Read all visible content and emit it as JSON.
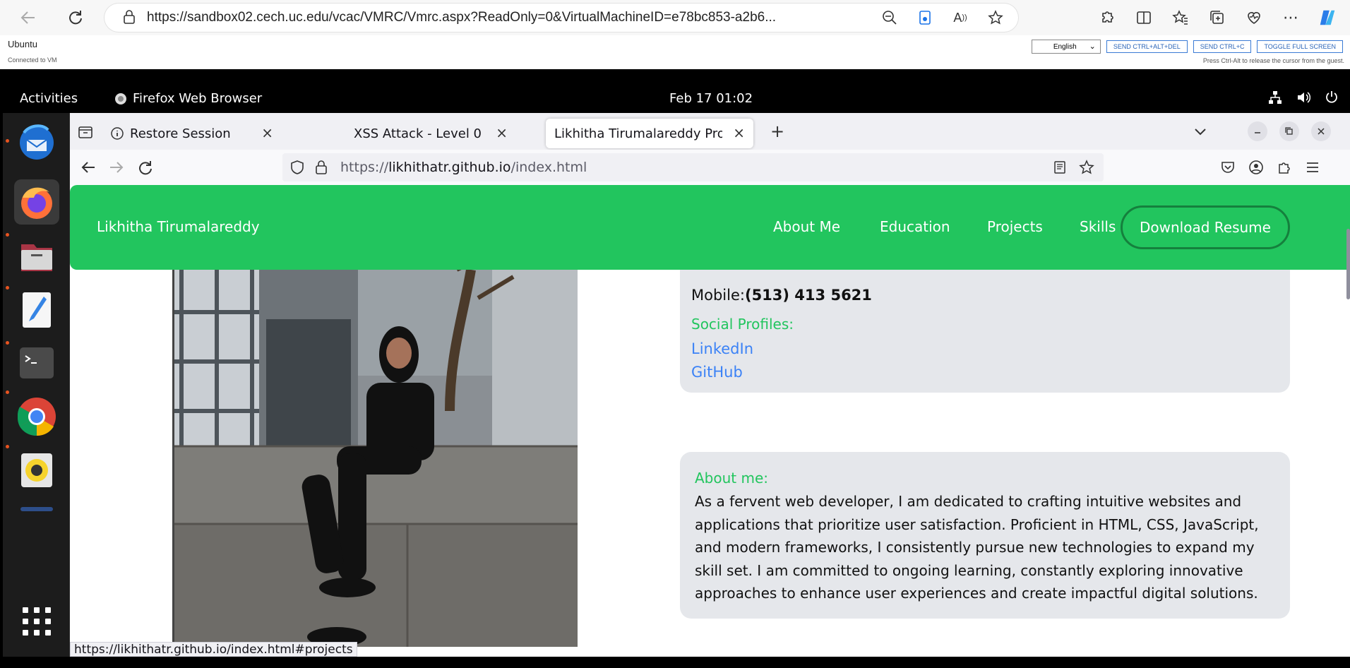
{
  "edge": {
    "url": "https://sandbox02.cech.uc.edu/vcac/VMRC/Vmrc.aspx?ReadOnly=0&VirtualMachineID=e78bc853-a2b6..."
  },
  "vmrc": {
    "vm_name": "Ubuntu",
    "status": "Connected to VM",
    "language": "English",
    "buttons": [
      "SEND CTRL+ALT+DEL",
      "SEND CTRL+C",
      "TOGGLE FULL SCREEN"
    ],
    "hint": "Press Ctrl-Alt to release the cursor from the guest."
  },
  "ubuntu": {
    "activities": "Activities",
    "app_name": "Firefox Web Browser",
    "clock": "Feb 17  01:02",
    "accent": "#e95420"
  },
  "firefox": {
    "tabs": [
      {
        "label": "Restore Session"
      },
      {
        "label": "XSS Attack - Level 0"
      },
      {
        "label": "Likhitha Tirumalareddy Profe"
      }
    ],
    "url_prefix": "https://",
    "url_domain": "likhithatr.github.io",
    "url_path": "/index.html",
    "status_url": "https://likhithatr.github.io/index.html#projects"
  },
  "site": {
    "accent": "#22c55e",
    "brand": "Likhitha Tirumalareddy",
    "nav": [
      "About Me",
      "Education",
      "Projects",
      "Skills"
    ],
    "resume": "Download Resume",
    "mobile_label": "Mobile:",
    "mobile_value": "(513) 413 5621",
    "social_heading": "Social Profiles:",
    "links": [
      "LinkedIn",
      "GitHub"
    ],
    "about_heading": "About me:",
    "about_text": "As a fervent web developer, I am dedicated to crafting intuitive websites and applications that prioritize user satisfaction. Proficient in HTML, CSS, JavaScript, and modern frameworks, I consistently pursue new technologies to expand my skill set. I am committed to ongoing learning, constantly exploring innovative approaches to enhance user experiences and create impactful digital solutions."
  }
}
